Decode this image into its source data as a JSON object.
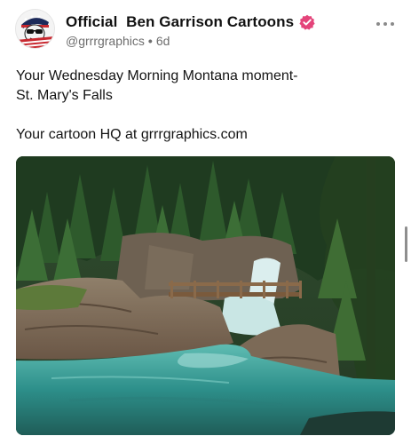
{
  "post": {
    "author": {
      "display_name": "Official  Ben Garrison Cartoons",
      "handle": "@grrrgraphics",
      "age": "6d",
      "verified_color": "#e4447a",
      "avatar_icon": "cartoon-character-avatar"
    },
    "more_icon": "more-horizontal-icon",
    "text": {
      "line1": "Your Wednesday Morning Montana moment-",
      "line2": "St. Mary's Falls",
      "line3": "Your cartoon HQ at grrrgraphics.com"
    },
    "image_subject": "st-marys-falls-photo"
  }
}
